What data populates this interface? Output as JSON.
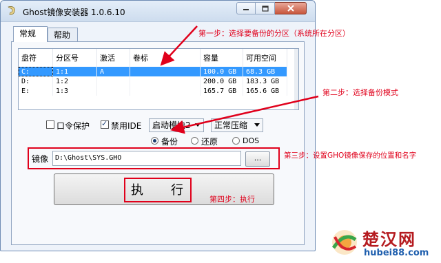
{
  "window": {
    "title": "Ghost镜像安装器 1.0.6.10"
  },
  "tabs": [
    {
      "label": "常规"
    },
    {
      "label": "帮助"
    }
  ],
  "partition_table": {
    "headers": [
      "盘符",
      "分区号",
      "激活",
      "卷标",
      "容量",
      "可用空间"
    ],
    "rows": [
      {
        "drive": "C:",
        "partition": "1:1",
        "active": "A",
        "label": "",
        "capacity": "100.0 GB",
        "free": "68.3 GB",
        "selected": true
      },
      {
        "drive": "D:",
        "partition": "1:2",
        "active": "",
        "label": "",
        "capacity": "200.0 GB",
        "free": "183.3 GB",
        "selected": false
      },
      {
        "drive": "E:",
        "partition": "1:3",
        "active": "",
        "label": "",
        "capacity": "165.7 GB",
        "free": "165.6 GB",
        "selected": false
      }
    ]
  },
  "options": {
    "password_protect": {
      "label": "口令保护",
      "checked": false
    },
    "disable_ide": {
      "label": "禁用IDE",
      "checked": true
    },
    "boot_module": "启动模块2",
    "compression": "正常压缩"
  },
  "mode": {
    "options": [
      "备份",
      "还原",
      "DOS"
    ],
    "selected": "备份"
  },
  "image": {
    "label": "镜像",
    "path": "D:\\Ghost\\SYS.GHO",
    "browse_label": "..."
  },
  "execute_label": "执行",
  "annotations": {
    "step1": "第一步：选择要备份的分区（系统所在分区）",
    "step2": "第二步：选择备份模式",
    "step3": "第三步：设置GHO镜像保存的位置和名字",
    "step4": "第四步：执行"
  },
  "watermark": {
    "brand": "楚汉网",
    "url": "hubei88.com"
  },
  "colors": {
    "annotation_red": "#e0001b",
    "selection_blue": "#3399ff"
  }
}
